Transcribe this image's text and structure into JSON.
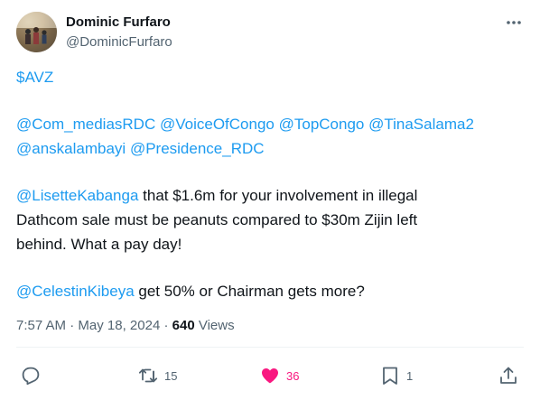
{
  "author": {
    "display_name": "Dominic Furfaro",
    "handle": "@DominicFurfaro"
  },
  "tweet": {
    "line1": "$AVZ",
    "mentions_1": [
      "@Com_mediasRDC",
      "@VoiceOfCongo",
      "@TopCongo",
      "@TinaSalama2",
      "@anskalambayi",
      "@Presidence_RDC"
    ],
    "para3_mention": "@LisetteKabanga",
    "para3_line1": " that $1.6m for your involvement in illegal",
    "para3_line2": "Dathcom sale must be peanuts compared to $30m Zijin left",
    "para3_line3": "behind. What a pay day!",
    "para4_mention": "@CelestinKibeya",
    "para4_text": " get 50% or Chairman gets more?"
  },
  "meta": {
    "time": "7:57 AM",
    "sep1": " · ",
    "date": "May 18, 2024",
    "sep2": " · ",
    "views_count": "640",
    "views_label": " Views"
  },
  "actions": {
    "reply_count": "",
    "retweet_count": "15",
    "like_count": "36",
    "bookmark_count": "1"
  },
  "colors": {
    "link": "#1d9bf0",
    "like": "#f91880",
    "secondary": "#536471"
  },
  "icons": [
    "more-icon",
    "reply-icon",
    "retweet-icon",
    "like-icon",
    "bookmark-icon",
    "share-icon"
  ]
}
